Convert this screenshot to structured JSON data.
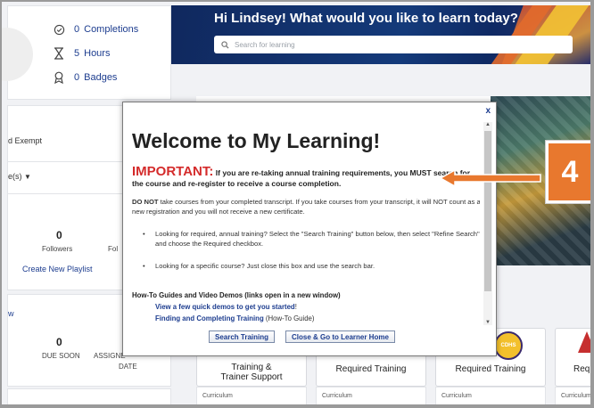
{
  "profile": {
    "stats": [
      {
        "icon": "check-circle-icon",
        "number": "0",
        "label": "Completions"
      },
      {
        "icon": "hourglass-icon",
        "number": "5",
        "label": "Hours"
      },
      {
        "icon": "badge-icon",
        "number": "0",
        "label": "Badges"
      }
    ],
    "exempt_label": "d Exempt",
    "filter_label": "e(s)",
    "followers_count": "0",
    "followers_label": "Followers",
    "following_label_partial": "Fol",
    "create_playlist": "Create New Playlist",
    "view_link_partial": "w",
    "due_soon_count": "0",
    "due_soon_label": "DUE SOON",
    "assigned_label_partial": "ASSIGNE",
    "date_label": "DATE"
  },
  "hero": {
    "greeting": "Hi Lindsey! What would you like to learn today?",
    "search_placeholder": "Search for learning"
  },
  "callout_number": "4",
  "tiles": [
    {
      "title": "Training &\nTrainer Support",
      "sub": "Curriculum"
    },
    {
      "title": "Required Training",
      "sub": "Curriculum"
    },
    {
      "title": "Required Training",
      "sub": "Curriculum"
    },
    {
      "title": "Req",
      "sub": "Curriculum"
    }
  ],
  "cdhs_label": "CDHS",
  "modal": {
    "close": "x",
    "title": "Welcome to My Learning!",
    "important_word": "IMPORTANT",
    "important_colon": ":",
    "important_text": "If you are re-taking annual training requirements, you MUST search for the course and re-register to receive a course completion.",
    "do_not": "DO NOT",
    "do_not_text": "take courses from your completed transcript. If you take courses from your transcript, it will NOT count as a new registration and you will not receive a new certificate.",
    "bullet1": "Looking for required, annual training? Select the \"Search Training\" button below, then select \"Refine Search\" and choose the Required checkbox.",
    "bullet2": "Looking for a specific course? Just close this box and use the search bar.",
    "howto_heading": "How-To Guides and Video Demos (links open in a new window)",
    "link1": "View a few quick demos to get you started",
    "link1_tail": "!",
    "link2": "Finding and Completing Training",
    "link2_tail": "(How-To Guide)",
    "btn_search": "Search Training",
    "btn_close": "Close & Go to Learner Home"
  },
  "colors": {
    "accent_blue": "#1d3d8f",
    "important_red": "#d42b2b",
    "callout_orange": "#e8782e"
  }
}
